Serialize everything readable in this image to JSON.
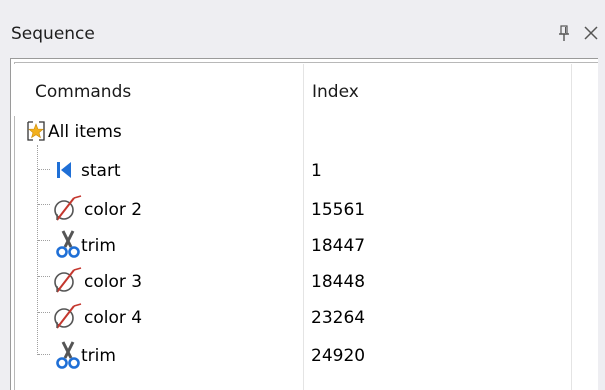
{
  "panel": {
    "title": "Sequence",
    "pin_icon": "pin-icon",
    "close_icon": "close-icon"
  },
  "table": {
    "columns": [
      "Commands",
      "Index"
    ],
    "root": {
      "label": "All items",
      "icon": "star-folder-icon"
    },
    "rows": [
      {
        "label": "start",
        "index": "1",
        "icon": "skip-to-start-icon"
      },
      {
        "label": "color 2",
        "index": "15561",
        "icon": "color-strike-icon"
      },
      {
        "label": "trim",
        "index": "18447",
        "icon": "scissors-icon"
      },
      {
        "label": "color 3",
        "index": "18448",
        "icon": "color-strike-icon"
      },
      {
        "label": "color 4",
        "index": "23264",
        "icon": "color-strike-icon"
      },
      {
        "label": "trim",
        "index": "24920",
        "icon": "scissors-icon"
      }
    ]
  },
  "colors": {
    "accent_blue": "#1f6fd6",
    "strike_red": "#c4372e"
  }
}
